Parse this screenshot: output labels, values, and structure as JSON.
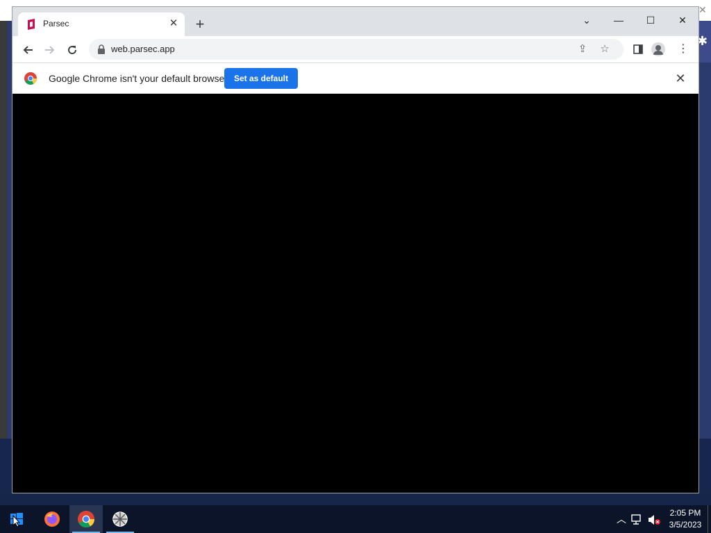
{
  "browser": {
    "tab": {
      "title": "Parsec",
      "favicon": "parsec-icon"
    },
    "new_tab": "+",
    "address": "web.parsec.app",
    "window_controls": {
      "tab_search": "⌄",
      "minimize": "—",
      "maximize": "☐",
      "close": "✕"
    }
  },
  "infobar": {
    "message": "Google Chrome isn't your default browser",
    "button_label": "Set as default"
  },
  "taskbar": {
    "apps": [
      "firefox-icon",
      "chrome-icon",
      "parsec-icon"
    ],
    "time": "2:05 PM",
    "date": "3/5/2023"
  },
  "colors": {
    "accent": "#1a73e8",
    "parsec_brand": "#c8104c"
  }
}
